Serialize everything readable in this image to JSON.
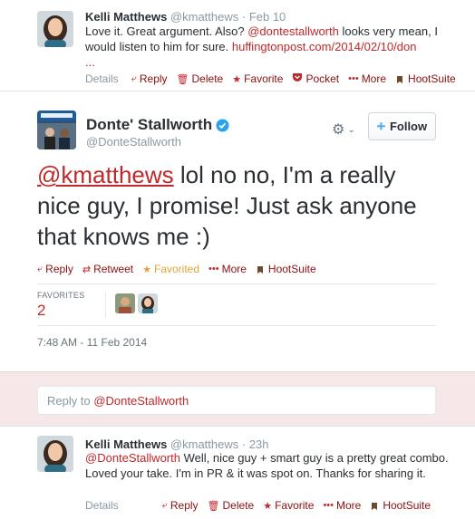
{
  "prev_tweet": {
    "name": "Kelli Matthews",
    "handle": "@kmatthews",
    "time": "· Feb 10",
    "text_before": "Love it. Great argument. Also? ",
    "mention": "@dontestallworth",
    "text_after": " looks very mean, I would listen to him for sure.  ",
    "link": "huffingtonpost.com/2014/02/10/don",
    "ellipsis": "...",
    "actions": {
      "details": "Details",
      "reply": "Reply",
      "delete": "Delete",
      "favorite": "Favorite",
      "pocket": "Pocket",
      "more": "More",
      "hootsuite": "HootSuite"
    }
  },
  "main_tweet": {
    "name": "Donte' Stallworth",
    "handle": "@DonteStallworth",
    "follow_label": "Follow",
    "mention": "@kmatthews",
    "text": " lol no no, I'm a really nice guy, I promise! Just ask anyone that knows me :)",
    "actions": {
      "reply": "Reply",
      "retweet": "Retweet",
      "favorited": "Favorited",
      "more": "More",
      "hootsuite": "HootSuite"
    },
    "favorites_label": "FAVORITES",
    "favorites_count": "2",
    "timestamp": "7:48 AM - 11 Feb 2014"
  },
  "reply_box": {
    "prefix": "Reply to ",
    "mention": "@DonteStallworth"
  },
  "reply_tweet": {
    "name": "Kelli Matthews",
    "handle": "@kmatthews",
    "time": "· 23h",
    "mention": "@DonteStallworth",
    "text": " Well, nice guy + smart guy is a pretty great combo. Loved your take. I'm in PR & it was spot on. Thanks for sharing it.",
    "actions": {
      "details": "Details",
      "reply": "Reply",
      "delete": "Delete",
      "favorite": "Favorite",
      "more": "More",
      "hootsuite": "HootSuite"
    }
  },
  "colors": {
    "accent": "#c0292a",
    "favorited": "#e0a33a",
    "verified": "#2aa3ef",
    "reply_bg": "#f6e8e8"
  },
  "icons": [
    "reply-icon",
    "trash-icon",
    "star-icon",
    "pocket-icon",
    "more-dots-icon",
    "hootsuite-icon",
    "retweet-icon",
    "gear-icon",
    "chevron-down-icon",
    "follow-person-icon",
    "verified-badge-icon"
  ]
}
